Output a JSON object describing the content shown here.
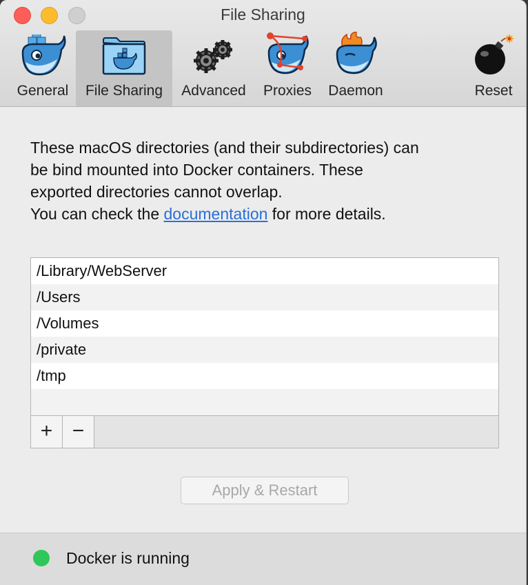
{
  "window": {
    "title": "File Sharing"
  },
  "toolbar": {
    "items": [
      {
        "label": "General",
        "icon": "docker-whale-icon"
      },
      {
        "label": "File Sharing",
        "icon": "folder-whale-icon",
        "active": true
      },
      {
        "label": "Advanced",
        "icon": "gears-icon"
      },
      {
        "label": "Proxies",
        "icon": "network-whale-icon"
      },
      {
        "label": "Daemon",
        "icon": "fire-whale-icon"
      },
      {
        "label": "Reset",
        "icon": "bomb-icon"
      }
    ]
  },
  "description": {
    "line1": "These macOS directories (and their subdirectories) can",
    "line2": "be bind mounted into Docker containers. These",
    "line3": "exported directories cannot overlap.",
    "line4_pre": "You can check the ",
    "link": "documentation",
    "line4_post": " for more details."
  },
  "directories": [
    "/Library/WebServer",
    "/Users",
    "/Volumes",
    "/private",
    "/tmp"
  ],
  "list_buttons": {
    "add": "+",
    "remove": "−"
  },
  "apply_button": "Apply & Restart",
  "status": {
    "text": "Docker is running",
    "color": "#2fc65a"
  }
}
